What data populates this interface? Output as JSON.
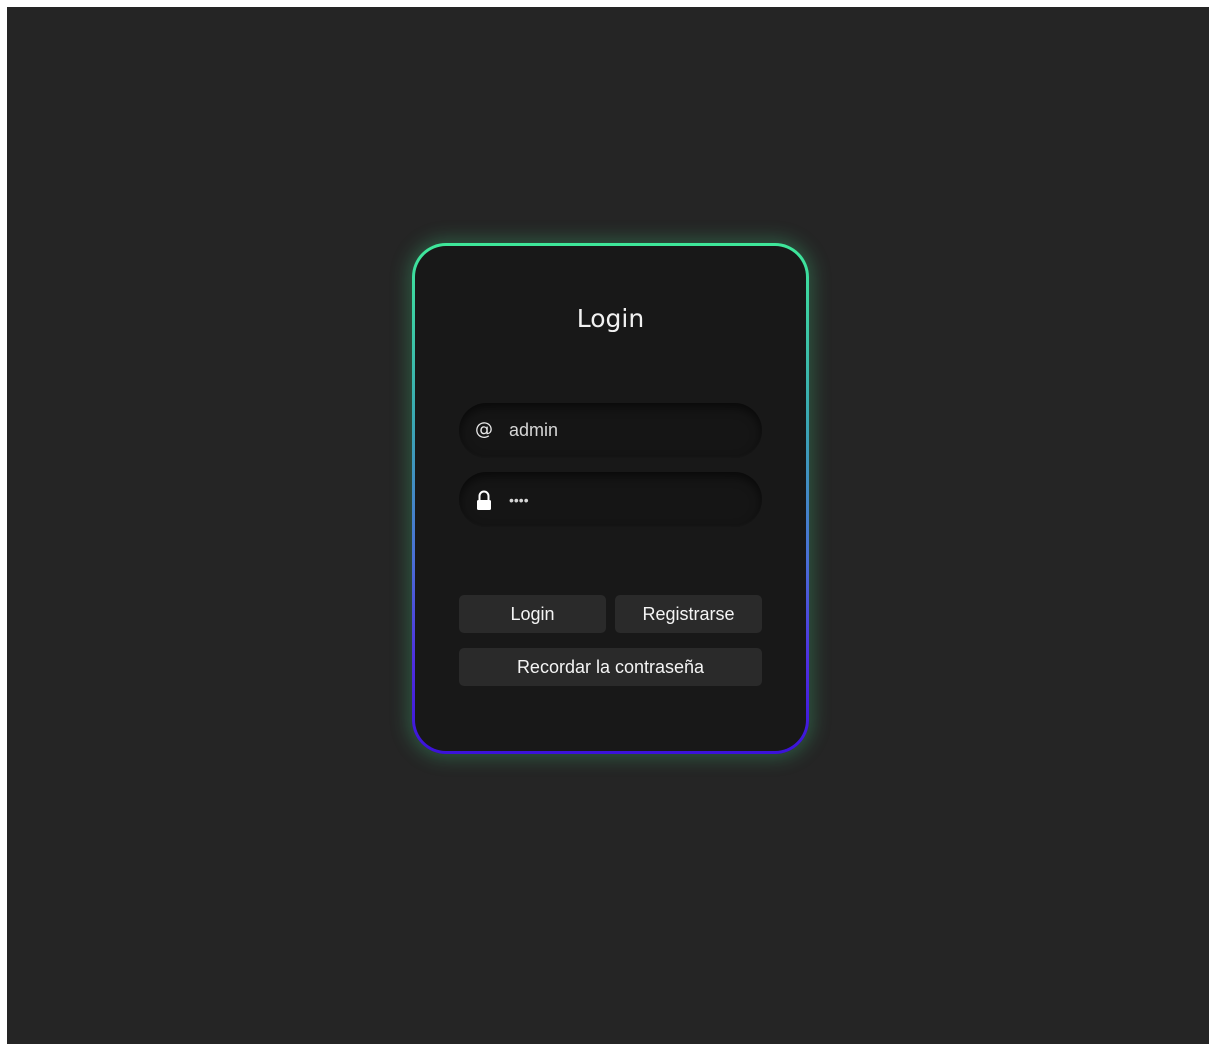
{
  "login_form": {
    "title": "Login",
    "email": {
      "icon": "at-icon",
      "icon_glyph": "@",
      "value": "admin"
    },
    "password": {
      "icon": "lock-icon",
      "value": "••••"
    },
    "buttons": {
      "login_label": "Login",
      "register_label": "Registrarse",
      "remember_label": "Recordar la contraseña"
    }
  },
  "colors": {
    "background": "#252525",
    "card": "#181818",
    "border_gradient_top": "#3ee89a",
    "border_gradient_bottom": "#3b12d9",
    "button": "#2a2a2a"
  }
}
